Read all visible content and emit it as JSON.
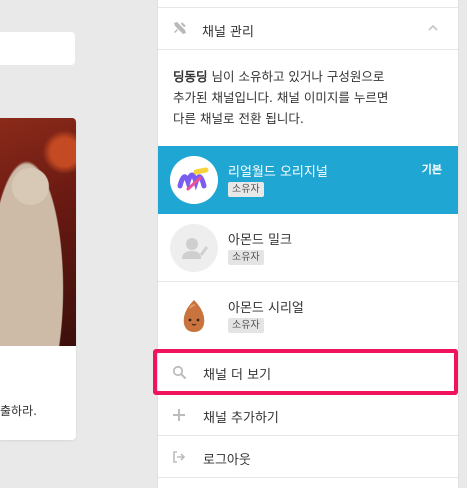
{
  "background": {
    "partial_text": "출하라."
  },
  "panel": {
    "manage": {
      "label": "채널 관리",
      "icon": "tools-icon"
    },
    "description": {
      "owner_name": "딩동딩",
      "line1_rest": " 님이 소유하고 있거나 구성원으로",
      "line2": "추가된 채널입니다. 채널 이미지를 누르면",
      "line3": "다른 채널로 전환 됩니다."
    },
    "channels": [
      {
        "name": "리얼월드 오리지널",
        "role": "소유자",
        "default_tag": "기본",
        "active": true
      },
      {
        "name": "아몬드 밀크",
        "role": "소유자"
      },
      {
        "name": "아몬드 시리얼",
        "role": "소유자"
      }
    ],
    "menu": {
      "more": "채널 더 보기",
      "add": "채널 추가하기",
      "logout": "로그아웃"
    }
  },
  "colors": {
    "active_channel": "#1fa6d3",
    "highlight": "#f0145f"
  }
}
